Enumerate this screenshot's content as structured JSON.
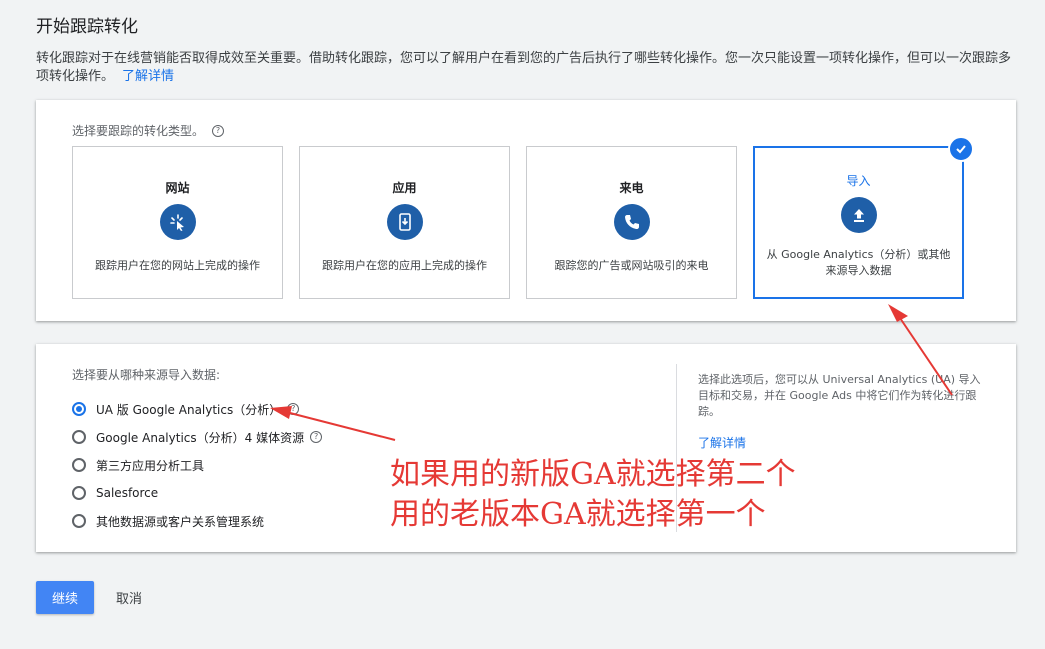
{
  "page": {
    "title": "开始跟踪转化",
    "intro": "转化跟踪对于在线营销能否取得成效至关重要。借助转化跟踪，您可以了解用户在看到您的广告后执行了哪些转化操作。您一次只能设置一项转化操作，但可以一次跟踪多项转化操作。",
    "intro_link": "了解详情"
  },
  "conversion_types": {
    "label": "选择要跟踪的转化类型。",
    "tiles": [
      {
        "title": "网站",
        "desc": "跟踪用户在您的网站上完成的操作",
        "icon": "cursor-click-icon"
      },
      {
        "title": "应用",
        "desc": "跟踪用户在您的应用上完成的操作",
        "icon": "mobile-app-icon"
      },
      {
        "title": "来电",
        "desc": "跟踪您的广告或网站吸引的来电",
        "icon": "phone-icon"
      },
      {
        "title": "导入",
        "desc": "从 Google Analytics（分析）或其他来源导入数据",
        "icon": "upload-icon",
        "selected": true
      }
    ]
  },
  "import_source": {
    "label": "选择要从哪种来源导入数据:",
    "options": [
      {
        "label": "UA 版 Google Analytics（分析）",
        "selected": true,
        "help": true
      },
      {
        "label": "Google Analytics（分析）4 媒体资源",
        "selected": false,
        "help": true
      },
      {
        "label": "第三方应用分析工具",
        "selected": false
      },
      {
        "label": "Salesforce",
        "selected": false
      },
      {
        "label": "其他数据源或客户关系管理系统",
        "selected": false
      }
    ],
    "side_text": "选择此选项后，您可以从 Universal Analytics (UA) 导入目标和交易，并在 Google Ads 中将它们作为转化进行跟踪。",
    "side_link": "了解详情"
  },
  "annotation": {
    "line1": "如果用的新版GA就选择第二个",
    "line2": "用的老版本GA就选择第一个",
    "color": "#e53935"
  },
  "actions": {
    "continue": "继续",
    "cancel": "取消"
  },
  "colors": {
    "accent": "#1a73e8",
    "icon_bg": "#1f5fa8",
    "button": "#4285f4"
  }
}
